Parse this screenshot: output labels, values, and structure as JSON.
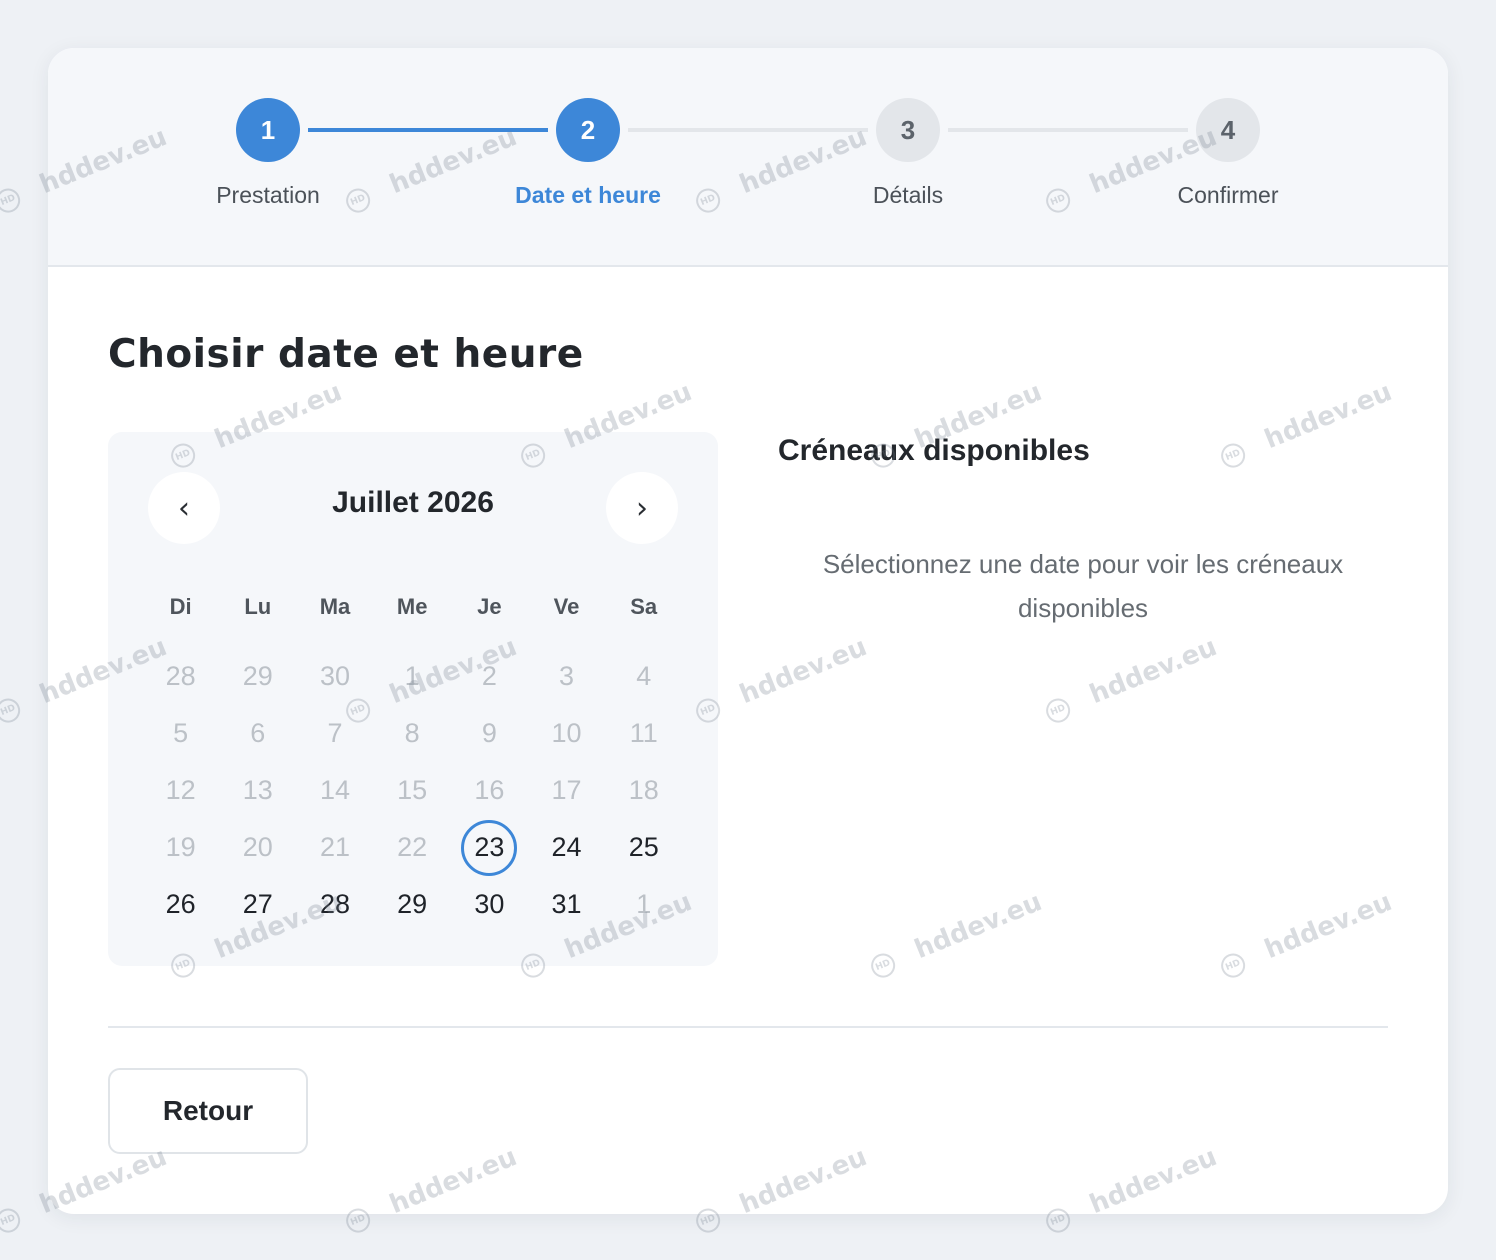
{
  "stepper": {
    "steps": [
      {
        "number": "1",
        "label": "Prestation"
      },
      {
        "number": "2",
        "label": "Date et heure"
      },
      {
        "number": "3",
        "label": "Détails"
      },
      {
        "number": "4",
        "label": "Confirmer"
      }
    ],
    "current_step": 2
  },
  "page_title": "Choisir date et heure",
  "calendar": {
    "prev_label": "‹",
    "next_label": "›",
    "month": "Juillet 2026",
    "weekdays": [
      "Di",
      "Lu",
      "Ma",
      "Me",
      "Je",
      "Ve",
      "Sa"
    ],
    "selected_day": "23",
    "weeks": [
      [
        "28",
        "29",
        "30",
        "1",
        "2",
        "3",
        "4"
      ],
      [
        "5",
        "6",
        "7",
        "8",
        "9",
        "10",
        "11"
      ],
      [
        "12",
        "13",
        "14",
        "15",
        "16",
        "17",
        "18"
      ],
      [
        "19",
        "20",
        "21",
        "22",
        "23",
        "24",
        "25"
      ],
      [
        "26",
        "27",
        "28",
        "29",
        "30",
        "31",
        "1"
      ]
    ]
  },
  "slots": {
    "title": "Créneaux disponibles",
    "empty_message": "Sélectionnez une date pour voir les créneaux disponibles"
  },
  "footer": {
    "back_label": "Retour"
  },
  "watermark": {
    "text": "hddev.eu",
    "badge": "HD"
  },
  "colors": {
    "accent": "#3d87d8",
    "muted_text": "#bcc1c7",
    "inactive_step": "#e3e6ea"
  }
}
